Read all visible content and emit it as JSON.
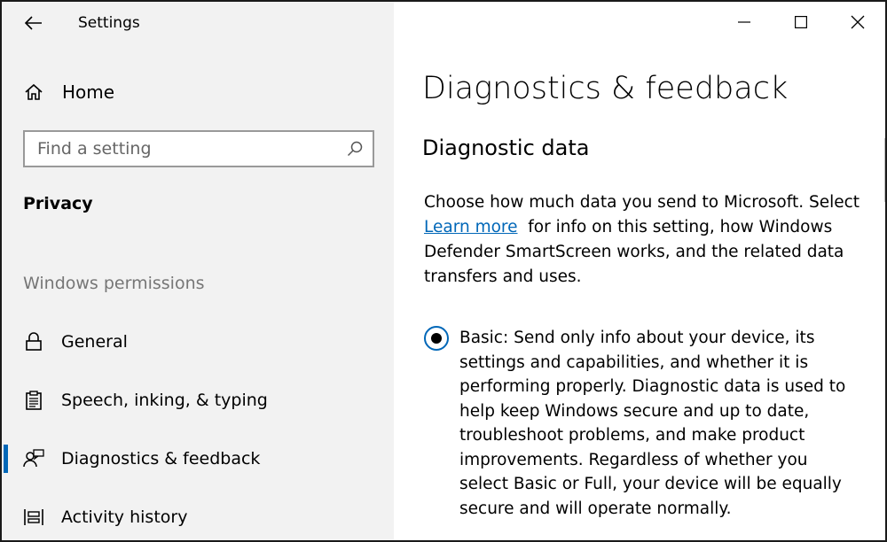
{
  "window": {
    "title": "Settings"
  },
  "sidebar": {
    "home_label": "Home",
    "search": {
      "placeholder": "Find a setting",
      "value": ""
    },
    "section_heading": "Privacy",
    "group_heading": "Windows permissions",
    "items": [
      {
        "label": "General",
        "icon": "lock-icon",
        "selected": false
      },
      {
        "label": "Speech, inking, & typing",
        "icon": "clipboard-icon",
        "selected": false
      },
      {
        "label": "Diagnostics & feedback",
        "icon": "feedback-person-icon",
        "selected": true
      },
      {
        "label": "Activity history",
        "icon": "timeline-icon",
        "selected": false
      }
    ]
  },
  "main": {
    "page_title": "Diagnostics & feedback",
    "section_title": "Diagnostic data",
    "desc_before": "Choose how much data you send to Microsoft. Select ",
    "learn_more": "Learn more",
    "desc_after": "  for info on this setting, how Windows Defender SmartScreen works, and the related data transfers and uses.",
    "basic_option": {
      "selected": true,
      "text": "Basic: Send only info about your device, its settings and capabilities, and whether it is performing properly. Diagnostic data is used to help keep Windows secure and up to date, troubleshoot problems, and make product improvements. Regardless of whether you select Basic or Full, your device will be equally secure and will operate normally."
    }
  },
  "colors": {
    "accent": "#0067b8",
    "sidebar_bg": "#f2f2f2",
    "muted": "#767676"
  }
}
